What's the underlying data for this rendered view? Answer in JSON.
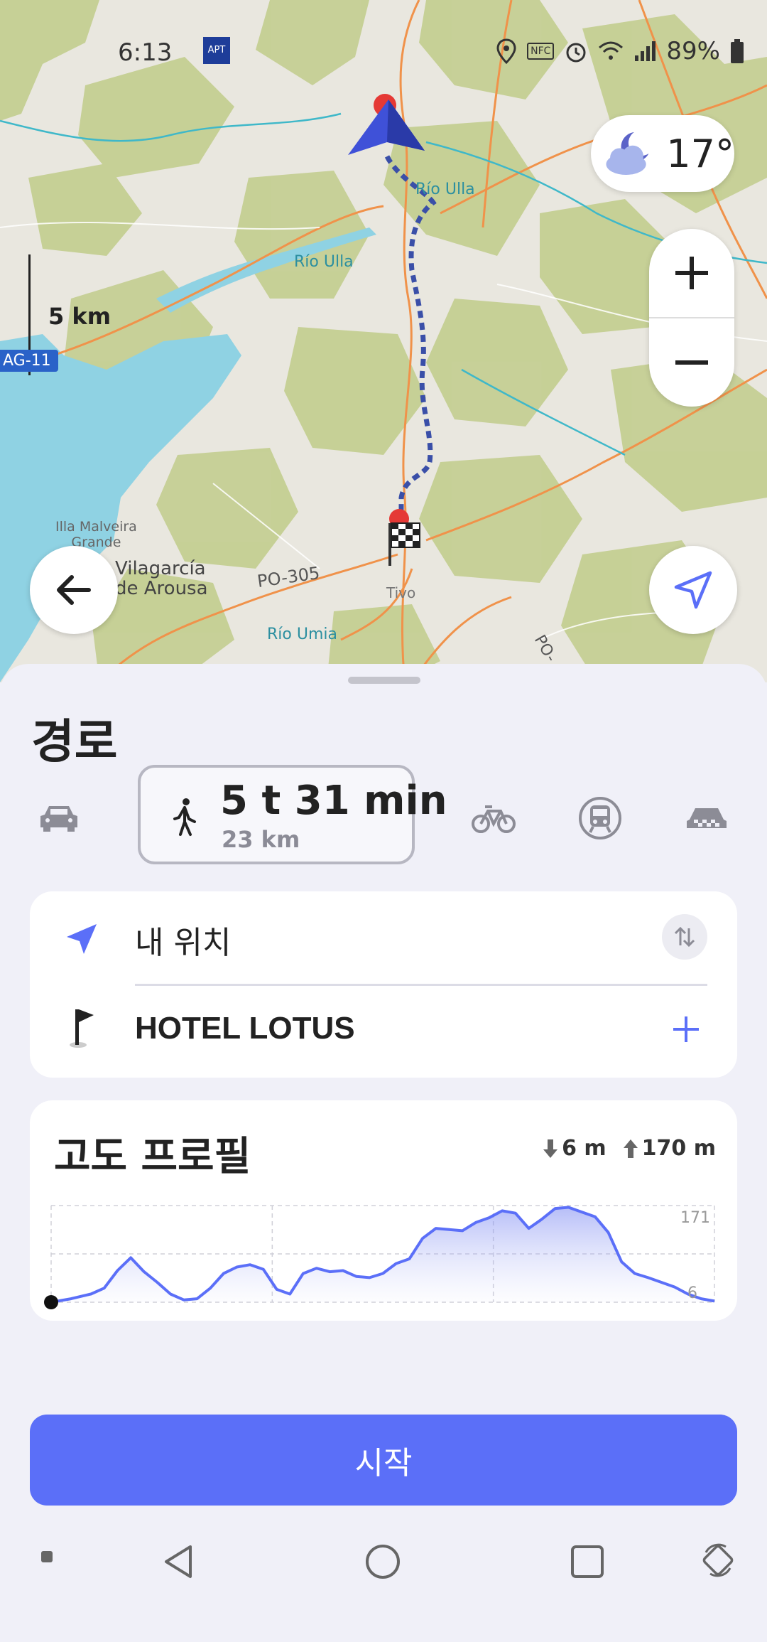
{
  "status_bar": {
    "time": "6:13",
    "app_badge": "APT",
    "battery": "89%",
    "nfc": "NFC"
  },
  "map": {
    "weather_temp": "17°",
    "scale_label": "5 km",
    "road_badge": "AG-11",
    "labels": {
      "rio_ulla_1": "Río Ulla",
      "rio_ulla_2": "Río Ulla",
      "illa": "Illa Malveira\nGrande",
      "vilagarcia": "Vilagarcía\nde Arousa",
      "po305": "PO-305",
      "tivo": "Tivo",
      "rio_umia": "Río Umia",
      "po_edge": "PO-"
    }
  },
  "sheet": {
    "title": "경로",
    "modes": {
      "selected_duration": "5 t 31 min",
      "selected_distance": "23 km",
      "icons": [
        "car-icon",
        "walk-icon",
        "bicycle-icon",
        "transit-icon",
        "taxi-icon"
      ]
    },
    "route": {
      "from": "내 위치",
      "to": "HOTEL LOTUS"
    },
    "elevation": {
      "title": "고도 프로필",
      "descent": "6 m",
      "ascent": "170 m",
      "max_label": "171",
      "min_label": "6"
    },
    "start_label": "시작"
  },
  "chart_data": {
    "type": "area",
    "title": "고도 프로필",
    "xlabel": "",
    "ylabel": "",
    "ylim": [
      6,
      171
    ],
    "grid": true,
    "x": [
      0,
      0.03,
      0.06,
      0.08,
      0.1,
      0.12,
      0.14,
      0.16,
      0.18,
      0.2,
      0.22,
      0.24,
      0.26,
      0.28,
      0.3,
      0.32,
      0.34,
      0.36,
      0.38,
      0.4,
      0.42,
      0.44,
      0.46,
      0.48,
      0.5,
      0.52,
      0.54,
      0.56,
      0.58,
      0.6,
      0.62,
      0.64,
      0.66,
      0.68,
      0.7,
      0.72,
      0.74,
      0.76,
      0.78,
      0.8,
      0.82,
      0.84,
      0.86,
      0.88,
      0.9,
      0.92,
      0.94,
      0.96,
      0.98,
      1.0
    ],
    "values": [
      6,
      12,
      20,
      30,
      60,
      82,
      58,
      40,
      20,
      10,
      12,
      30,
      55,
      66,
      70,
      62,
      28,
      20,
      55,
      64,
      58,
      60,
      50,
      48,
      55,
      72,
      80,
      115,
      132,
      130,
      128,
      142,
      150,
      162,
      158,
      132,
      148,
      166,
      168,
      160,
      152,
      125,
      75,
      55,
      48,
      40,
      32,
      20,
      12,
      8
    ]
  }
}
